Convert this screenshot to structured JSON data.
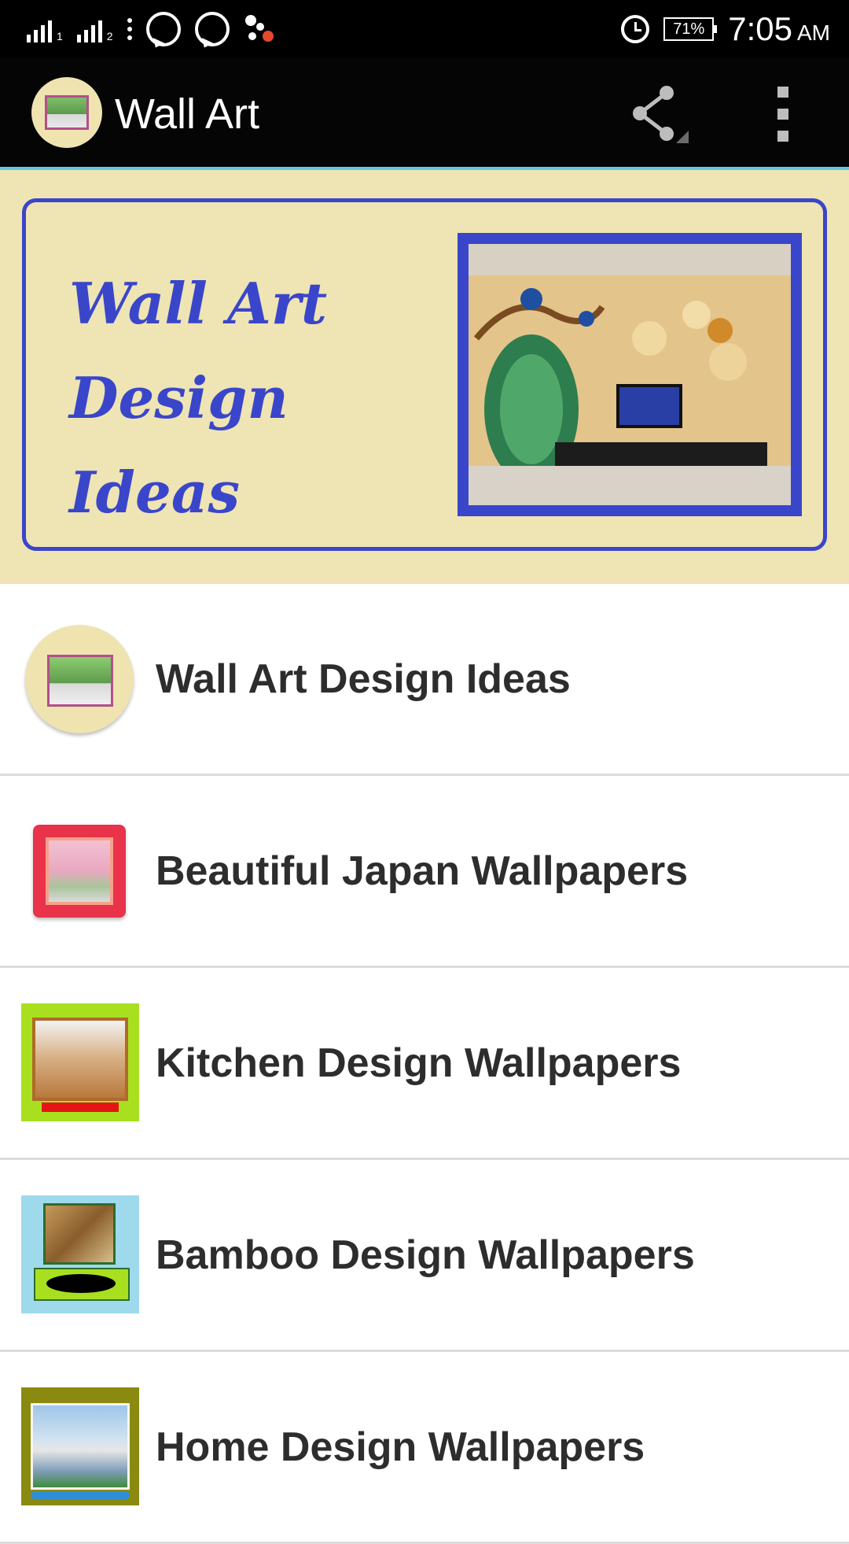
{
  "status_bar": {
    "sim1_label": "1",
    "sim2_label": "2",
    "battery_percent": "71%",
    "time": "7:05",
    "ampm": "AM"
  },
  "app_bar": {
    "title": "Wall Art",
    "icons": [
      "app-logo-icon",
      "share-icon",
      "overflow-menu-icon"
    ]
  },
  "banner": {
    "line1": "Wall Art",
    "line2": "Design Ideas"
  },
  "list": {
    "items": [
      {
        "label": "Wall Art Design Ideas"
      },
      {
        "label": "Beautiful Japan Wallpapers"
      },
      {
        "label": "Kitchen Design Wallpapers"
      },
      {
        "label": "Bamboo Design Wallpapers"
      },
      {
        "label": "Home Design Wallpapers"
      }
    ]
  },
  "colors": {
    "app_bar_bg": "#050505",
    "accent_line": "#5ec8e6",
    "banner_bg": "#efe4b4",
    "banner_blue": "#3a46c9",
    "list_text": "#2d2d2d",
    "divider": "#dcdcdc"
  }
}
